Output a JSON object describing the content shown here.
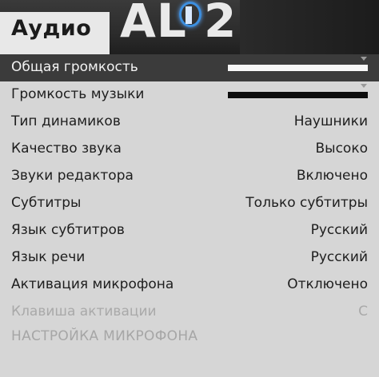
{
  "header": {
    "title": "Аудио",
    "background_logo": "AL 2"
  },
  "rows": [
    {
      "label": "Общая громкость",
      "type": "slider",
      "level": 1.0,
      "selected": true
    },
    {
      "label": "Громкость музыки",
      "type": "slider",
      "level": 1.0
    },
    {
      "label": "Тип динамиков",
      "value": "Наушники"
    },
    {
      "label": "Качество звука",
      "value": "Высоко"
    },
    {
      "label": "Звуки редактора",
      "value": "Включено"
    },
    {
      "label": "Субтитры",
      "value": "Только субтитры"
    },
    {
      "label": "Язык субтитров",
      "value": "Русский"
    },
    {
      "label": "Язык речи",
      "value": "Русский"
    },
    {
      "label": "Активация микрофона",
      "value": "Отключено"
    },
    {
      "label": "Клавиша активации",
      "value": "C",
      "disabled": true
    }
  ],
  "mic_settings_label": "НАСТРОЙКА МИКРОФОНА",
  "colors": {
    "panel": "#d7d7d7",
    "selected": "#3b3b3b",
    "disabled_text": "#a9a9a9"
  }
}
